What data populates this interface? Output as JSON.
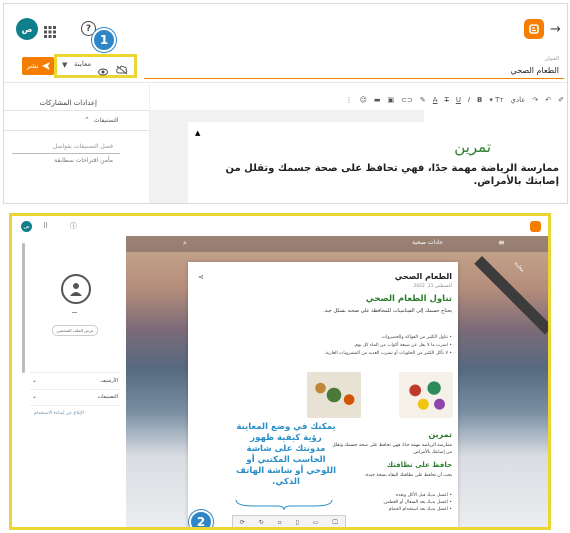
{
  "editor": {
    "user_avatar": "ص",
    "publish_label": "نشر",
    "preview_label": "معاينة",
    "title_label": "العنوان",
    "post_title": "الطعام الصحي",
    "toolbar_font": "عادي",
    "sidebar": {
      "post_settings": "إعدادات المشاركات",
      "labels": "التصنيفات",
      "labels_hint": "فصل التصنيفات بفواصل",
      "labels_suggestions": "مأمن اقتراحات سطابقة"
    },
    "content": {
      "heading": "تمرين",
      "body": "ممارسة الرياضة مهمة جدًا، فهي تحافظ على صحة جسمك وتقلل من إصابتك بالأمراض."
    }
  },
  "preview": {
    "avatar": "ص",
    "profile_button": "عرض الملف الشخصي",
    "archive": "الأرشيف",
    "labels": "التصنيفات",
    "report_abuse": "الإبلاغ عن إساءة الاستخدام",
    "blog_title": "عادات صحية",
    "ribbon": "معاينة",
    "post": {
      "title": "الطعام الصحي",
      "date": "أغسطس 11, 2022",
      "h1": "تناول الطعام الصحي",
      "intro": "يحتاج جسمك إلى الفيتامينات للمحافظة على صحته بشكل جيد.",
      "bullets": [
        "تناول الكثير من الفواكه والخضروات.",
        "اشرب ما لا يقل عن سبعة أكواب من الماء كل يوم.",
        "لا تأكل الكثير من الحلويات أو تشرب العديد من المشروبات الغازية."
      ],
      "h2": "تمرين",
      "p2": "ممارسة الرياضة مهمة جدًا، فهي تحافظ على صحة جسمك وتقلل من إصابتك بالأمراض.",
      "h3": "حافظ على نظافتك",
      "p3": "يجب أن تحافظ على نظافتك للبقاء بصحة جيدة.",
      "bullets2": [
        "اغسل يديك قبل الأكل وبعده",
        "اغسل يديك بعد السعال أو العطس.",
        "اغسل يديك بعد استخدام الحمام"
      ]
    },
    "callout": "يمكنك في وضع المعاينة رؤية كيفية ظهور مدونتك على شاشة الحاسب المكتبي أو اللوحي أو شاشة الهاتف الذكي."
  },
  "badges": {
    "one": "1",
    "two": "2"
  },
  "colors": {
    "accent_orange": "#f57d00",
    "highlight_yellow": "#ecd633",
    "badge_blue": "#2f86c7",
    "heading_green": "#2d7d2d",
    "callout_blue": "#2a8fc8",
    "avatar_teal": "#0f7f8c"
  }
}
